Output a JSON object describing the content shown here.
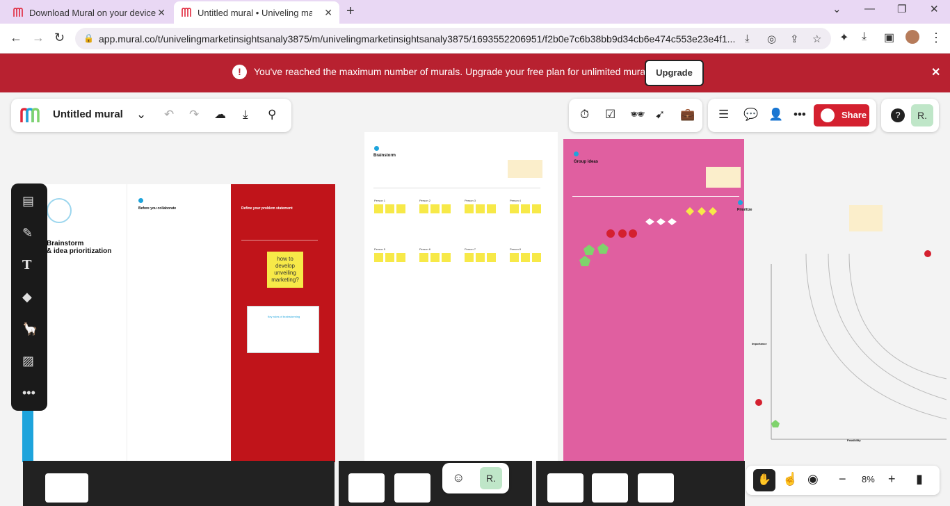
{
  "browser": {
    "tabs": [
      {
        "title": "Download Mural on your device",
        "active": false
      },
      {
        "title": "Untitled mural • Univeling marke",
        "active": true
      }
    ],
    "url": "app.mural.co/t/univelingmarketinsightsanaly3875/m/univelingmarketinsightsanaly3875/1693552206951/f2b0e7c6b38bb9d34cb6e474c553e23e4f1..."
  },
  "banner": {
    "message": "You've reached the maximum number of murals. Upgrade your free plan for unlimited murals.",
    "upgrade_label": "Upgrade"
  },
  "toolbar": {
    "mural_title": "Untitled mural",
    "share_label": "Share",
    "avatar_initial": "R."
  },
  "canvas": {
    "brainstorm_title": "Brainstorm\n& idea prioritization",
    "before_title": "Before you collaborate",
    "define_title": "Define your problem statement",
    "sticky_problem": "how to develop unveiling marketing?",
    "rules_title": "Key rules of brainstorming",
    "brainstorm_heading": "Brainstorm",
    "group_heading": "Group ideas",
    "prioritize_heading": "Prioritize",
    "importance_label": "Importance",
    "feasibility_label": "Feasibility",
    "person_labels": [
      "Person 1",
      "Person 2",
      "Person 3",
      "Person 4",
      "Person 5",
      "Person 6",
      "Person 7",
      "Person 8"
    ]
  },
  "bottom": {
    "avatar_initial": "R.",
    "zoom_level": "8%"
  },
  "colors": {
    "brand_red": "#d4202f",
    "banner_red": "#b82130",
    "define_red": "#c0141a",
    "group_pink": "#e05fa0",
    "sticky_yellow": "#f7e948"
  }
}
